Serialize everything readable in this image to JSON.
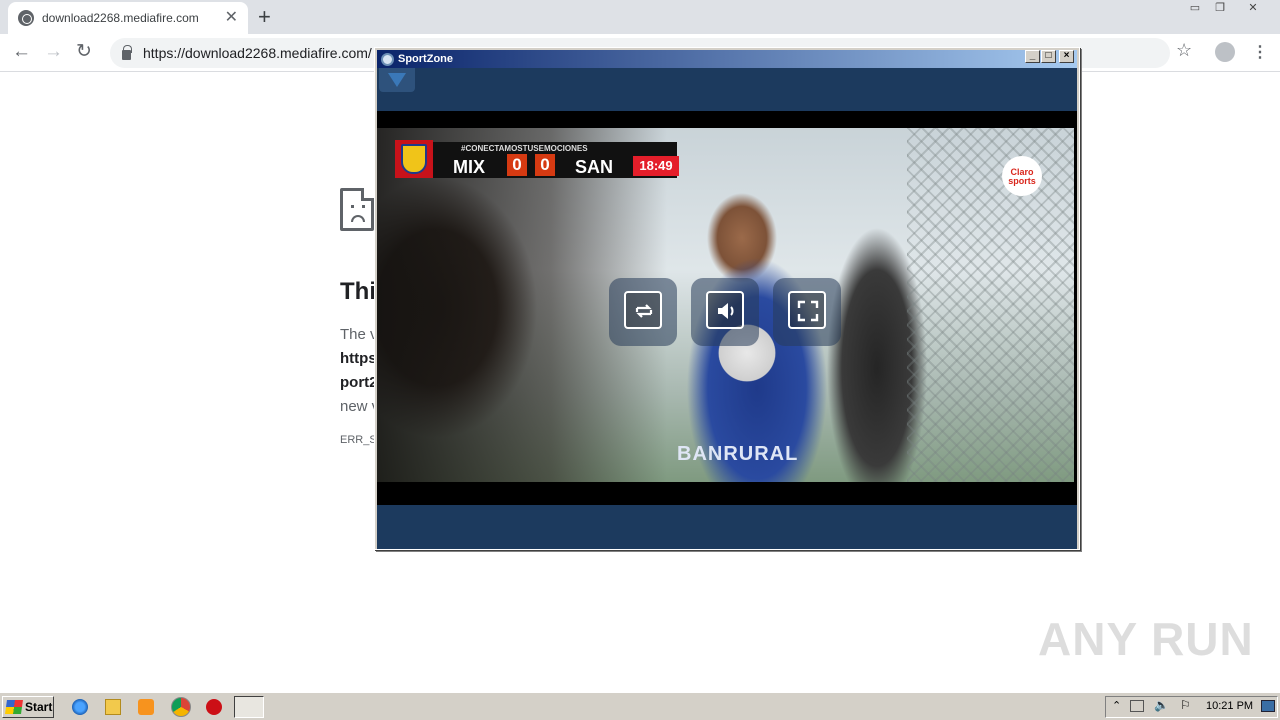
{
  "browser": {
    "tab_title": "download2268.mediafire.com",
    "url": "https://download2268.mediafire.com/"
  },
  "error_page": {
    "heading": "Thi",
    "line1": "The v",
    "line2": "https",
    "line3": "port2",
    "line4": "new v",
    "code": "ERR_S"
  },
  "app_window": {
    "title": "SportZone",
    "scoreboard": {
      "hashtag": "#CONECTAMOSTUSEMOCIONES",
      "home": "MIX",
      "home_score": "0",
      "away_score": "0",
      "away": "SAN",
      "time": "18:49"
    },
    "broadcaster": "Claro sports",
    "jersey_text": "BANRURAL",
    "controls": [
      "repeat-icon",
      "volume-icon",
      "fullscreen-icon"
    ]
  },
  "taskbar": {
    "start_label": "Start",
    "clock": "10:21 PM"
  },
  "watermark": "ANY RUN"
}
